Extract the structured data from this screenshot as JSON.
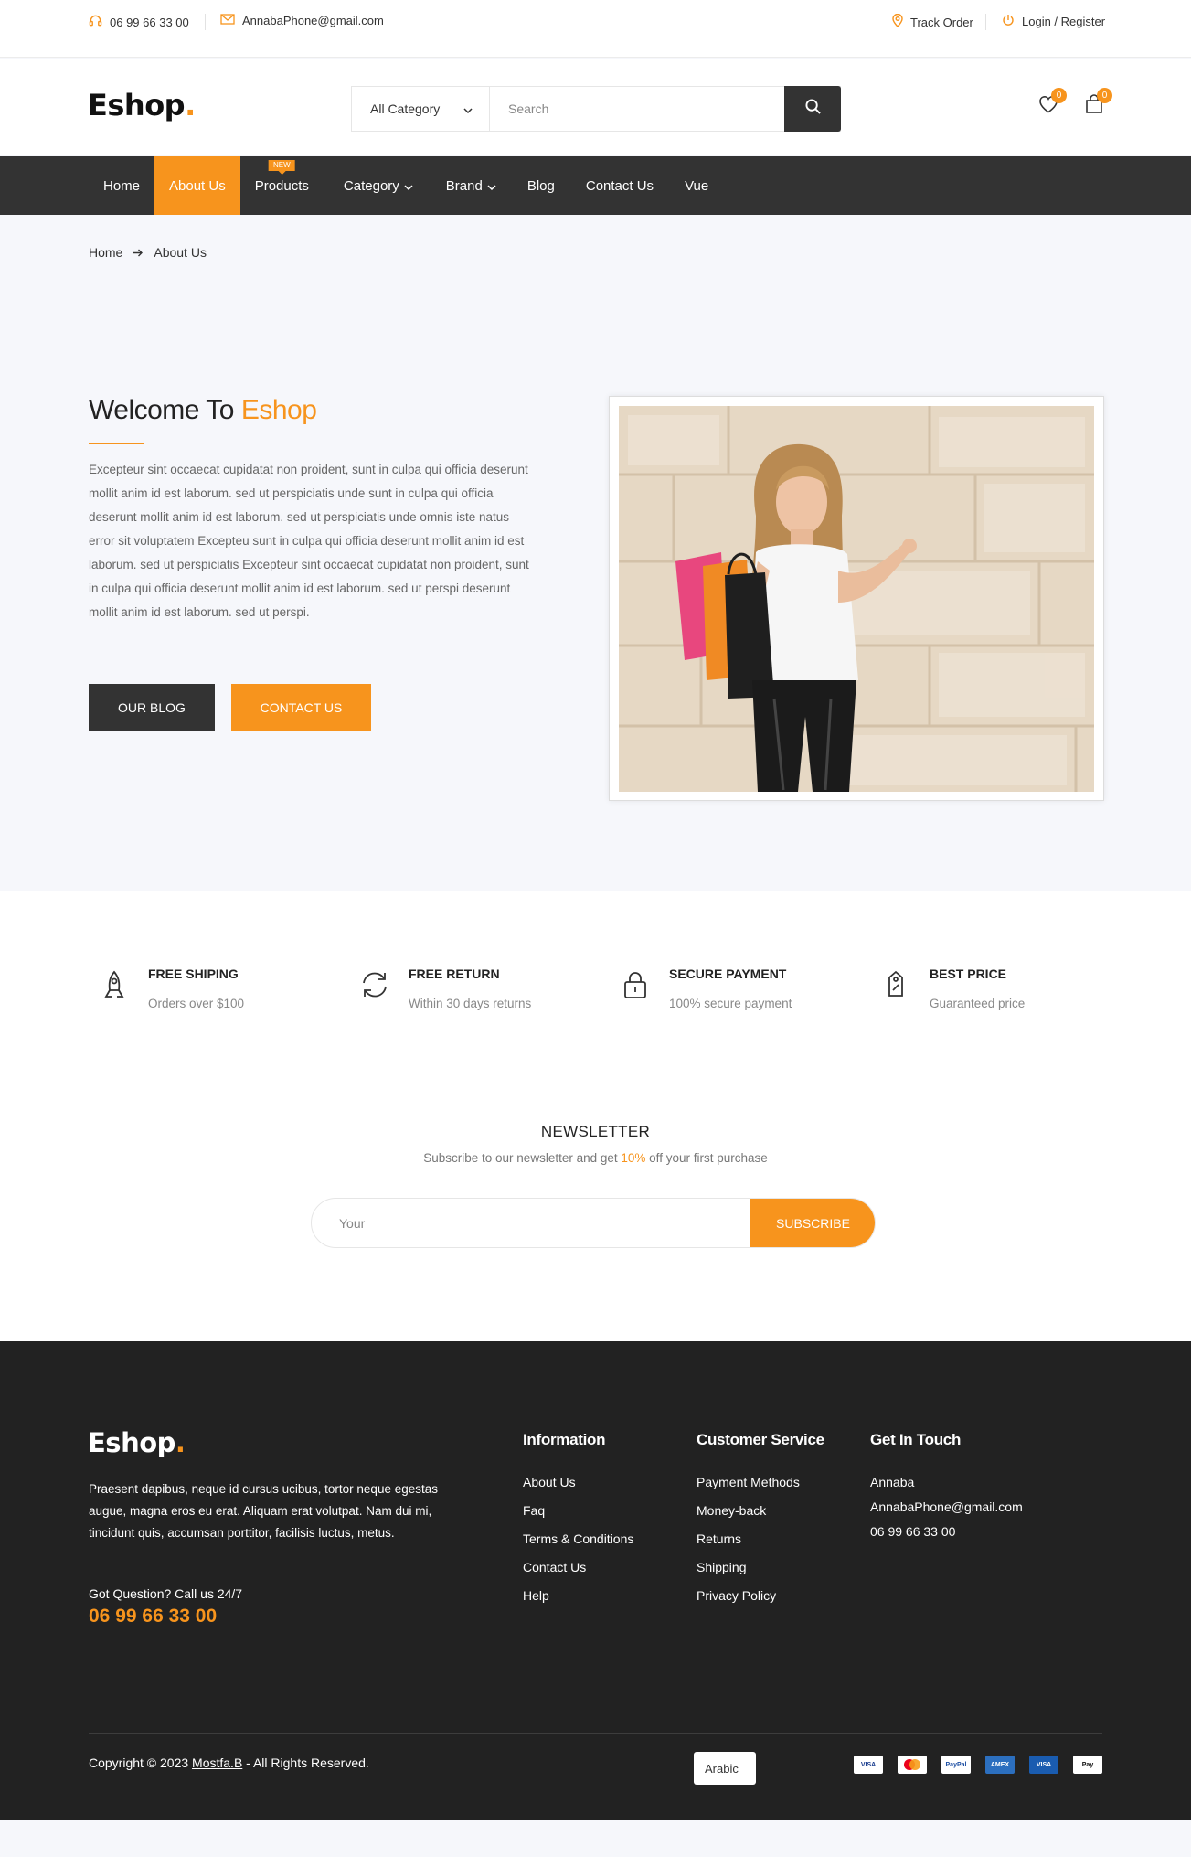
{
  "topbar": {
    "phone": "06 99 66 33 00",
    "email": "AnnabaPhone@gmail.com",
    "track_order": "Track Order",
    "login": "Login / Register"
  },
  "header": {
    "logo_text": "Eshop",
    "logo_dot": ".",
    "category_label": "All Category",
    "search_placeholder": "Search",
    "wishlist_count": "0",
    "cart_count": "0"
  },
  "nav": {
    "items": [
      "Home",
      "About Us",
      "Products",
      "Category",
      "Brand",
      "Blog",
      "Contact Us",
      "Vue"
    ],
    "active": "About Us",
    "new_badge": "NEW"
  },
  "breadcrumb": {
    "home": "Home",
    "current": "About Us"
  },
  "about": {
    "title_prefix": "Welcome To",
    "title_accent": "Eshop",
    "body": "Excepteur sint occaecat cupidatat non proident, sunt in culpa qui officia deserunt mollit anim id est laborum. sed ut perspiciatis unde sunt in culpa qui officia deserunt mollit anim id est laborum. sed ut perspiciatis unde omnis iste natus error sit voluptatem Excepteu sunt in culpa qui officia deserunt mollit anim id est laborum. sed ut perspiciatis Excepteur sint occaecat cupidatat non proident, sunt in culpa qui officia deserunt mollit anim id est laborum. sed ut perspi deserunt mollit anim id est laborum. sed ut perspi.",
    "btn_blog": "OUR BLOG",
    "btn_contact": "CONTACT US"
  },
  "services": [
    {
      "title": "Free shiping",
      "sub": "Orders over $100",
      "icon": "rocket-icon"
    },
    {
      "title": "Free Return",
      "sub": "Within 30 days returns",
      "icon": "refresh-icon"
    },
    {
      "title": "Secure Payment",
      "sub": "100% secure payment",
      "icon": "lock-icon"
    },
    {
      "title": "Best Price",
      "sub": "Guaranteed price",
      "icon": "tag-icon"
    }
  ],
  "newsletter": {
    "title": "NEWSLETTER",
    "sub_before": "Subscribe to our newsletter and get ",
    "sub_accent": "10%",
    "sub_after": " off your first purchase",
    "placeholder": "Your",
    "button": "SUBSCRIBE"
  },
  "footer": {
    "logo_text": "Eshop",
    "logo_dot": ".",
    "desc": "Praesent dapibus, neque id cursus ucibus, tortor neque egestas augue, magna eros eu erat. Aliquam erat volutpat. Nam dui mi, tincidunt quis, accumsan porttitor, facilisis luctus, metus.",
    "question": "Got Question? Call us 24/7",
    "phone": "06 99 66 33 00",
    "information": {
      "title": "Information",
      "links": [
        "About Us",
        "Faq",
        "Terms & Conditions",
        "Contact Us",
        "Help"
      ]
    },
    "customer_service": {
      "title": "Customer Service",
      "links": [
        "Payment Methods",
        "Money-back",
        "Returns",
        "Shipping",
        "Privacy Policy"
      ]
    },
    "get_in_touch": {
      "title": "Get In Touch",
      "lines": [
        "Annaba",
        "AnnabaPhone@gmail.com",
        "06 99 66 33 00"
      ]
    },
    "copyright_before": "Copyright © 2023 ",
    "copyright_author": "Mostfa.B",
    "copyright_after": " - All Rights Reserved.",
    "language": "Arabic",
    "payments": [
      "VISA",
      "mastercard",
      "PayPal",
      "AMEX",
      "VISA",
      "Pay"
    ]
  },
  "colors": {
    "accent": "#f7941d",
    "dark": "#333333",
    "footer_bg": "#222222"
  }
}
